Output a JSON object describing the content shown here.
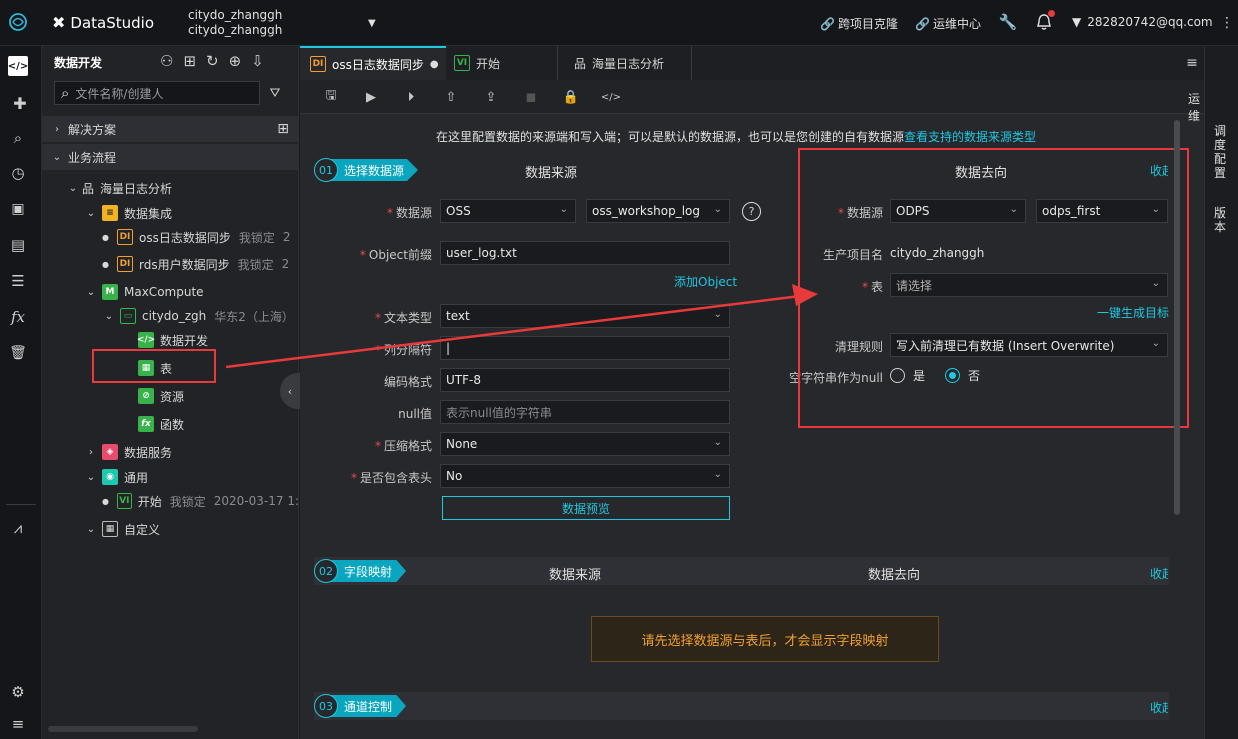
{
  "topbar": {
    "brand": "DataStudio",
    "workspace_line1": "citydo_zhanggh",
    "workspace_line2": "citydo_zhanggh",
    "clone_label": "跨项目克隆",
    "ops_label": "运维中心",
    "user": "282820742@qq.com"
  },
  "iconbar": {
    "icons": [
      "code-icon",
      "plugin-icon",
      "search-icon",
      "clock-icon",
      "briefcase-icon",
      "table-icon",
      "list-icon",
      "fx-icon",
      "trash-icon",
      "graph-icon",
      "settings-icon",
      "menu-icon"
    ]
  },
  "sidebar": {
    "title": "数据开发",
    "search_placeholder": "文件名称/创建人",
    "solutions": "解决方案",
    "business_flow": "业务流程",
    "flow_name": "海量日志分析",
    "data_integration": "数据集成",
    "node1_name": "oss日志数据同步",
    "node1_lock": "我锁定",
    "node1_extra": "2",
    "node2_name": "rds用户数据同步",
    "node2_lock": "我锁定",
    "node2_extra": "2",
    "maxcompute": "MaxCompute",
    "engine_name": "citydo_zgh",
    "engine_region": "华东2（上海）",
    "data_dev": "数据开发",
    "table": "表",
    "resource": "资源",
    "function": "函数",
    "data_service": "数据服务",
    "general": "通用",
    "start_node": "开始",
    "start_lock": "我锁定",
    "start_date": "2020-03-17 1:",
    "custom": "自定义"
  },
  "tabs": {
    "tab1": "oss日志数据同步",
    "tab2": "开始",
    "tab3": "海量日志分析",
    "ops_link": "运维"
  },
  "content": {
    "info_text": "在这里配置数据的来源端和写入端；可以是默认的数据源，也可以是您创建的自有数据源",
    "info_link": "查看支持的数据来源类型",
    "section1_num": "01",
    "section1_tag": "选择数据源",
    "source_header": "数据来源",
    "target_header": "数据去向",
    "collapse": "收起",
    "src_datasource_label": "数据源",
    "src_datasource_type": "OSS",
    "src_datasource_name": "oss_workshop_log",
    "object_prefix_label": "Object前缀",
    "object_prefix_value": "user_log.txt",
    "add_object": "添加Object",
    "text_type_label": "文本类型",
    "text_type_value": "text",
    "delimiter_label": "列分隔符",
    "delimiter_value": "|",
    "encoding_label": "编码格式",
    "encoding_value": "UTF-8",
    "null_label": "null值",
    "null_placeholder": "表示null值的字符串",
    "compress_label": "压缩格式",
    "compress_value": "None",
    "header_label": "是否包含表头",
    "header_value": "No",
    "preview_button": "数据预览",
    "dst_datasource_label": "数据源",
    "dst_datasource_type": "ODPS",
    "dst_datasource_name": "odps_first",
    "prod_project_label": "生产项目名",
    "prod_project_value": "citydo_zhanggh",
    "table_label": "表",
    "table_placeholder": "请选择",
    "gen_target": "一键生成目标",
    "clean_rule_label": "清理规则",
    "clean_rule_value": "写入前清理已有数据 (Insert Overwrite)",
    "empty_null_label": "空字符串作为null",
    "radio_yes": "是",
    "radio_no": "否",
    "section2_num": "02",
    "section2_tag": "字段映射",
    "mapping_source": "数据来源",
    "mapping_target": "数据去向",
    "mapping_warning": "请先选择数据源与表后，才会显示字段映射",
    "section3_num": "03",
    "section3_tag": "通道控制"
  },
  "rightbar": {
    "schedule": "调度配置",
    "version": "版本"
  },
  "colors": {
    "accent": "#1ec8e0",
    "annotation_red": "#e83a3a",
    "warning_text": "#f0a030"
  }
}
